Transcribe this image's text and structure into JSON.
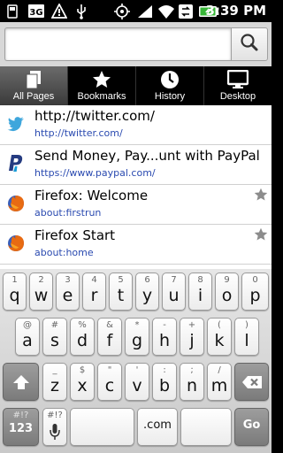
{
  "status_bar": {
    "time": "3:39 PM",
    "icons": [
      "usb-icon",
      "3g-signal-icon",
      "warning-icon",
      "usb-debug-icon",
      "gps-icon",
      "signal-icon",
      "wifi-icon",
      "battery-icon"
    ]
  },
  "url_bar": {
    "value": "",
    "placeholder": "",
    "search_icon": "search-icon"
  },
  "tabs": [
    {
      "label": "All Pages",
      "icon": "pages-icon",
      "selected": true
    },
    {
      "label": "Bookmarks",
      "icon": "star-icon",
      "selected": false
    },
    {
      "label": "History",
      "icon": "clock-icon",
      "selected": false
    },
    {
      "label": "Desktop",
      "icon": "monitor-icon",
      "selected": false
    }
  ],
  "list": [
    {
      "title": "http://twitter.com/",
      "url": "http://twitter.com/",
      "favicon": "twitter-bird-icon",
      "starred": false
    },
    {
      "title": "Send Money, Pay...unt with PayPal",
      "url": "https://www.paypal.com/",
      "favicon": "paypal-icon",
      "starred": false
    },
    {
      "title": "Firefox: Welcome",
      "url": "about:firstrun",
      "favicon": "firefox-icon",
      "starred": true
    },
    {
      "title": "Firefox Start",
      "url": "about:home",
      "favicon": "firefox-icon",
      "starred": true
    }
  ],
  "keyboard": {
    "row1": [
      {
        "main": "q",
        "alt": "1"
      },
      {
        "main": "w",
        "alt": "2"
      },
      {
        "main": "e",
        "alt": "3"
      },
      {
        "main": "r",
        "alt": "4"
      },
      {
        "main": "t",
        "alt": "5"
      },
      {
        "main": "y",
        "alt": "6"
      },
      {
        "main": "u",
        "alt": "7"
      },
      {
        "main": "i",
        "alt": "8"
      },
      {
        "main": "o",
        "alt": "9"
      },
      {
        "main": "p",
        "alt": "0"
      }
    ],
    "row2": [
      {
        "main": "a",
        "alt": "@"
      },
      {
        "main": "s",
        "alt": "#"
      },
      {
        "main": "d",
        "alt": "%"
      },
      {
        "main": "f",
        "alt": "&"
      },
      {
        "main": "g",
        "alt": "*"
      },
      {
        "main": "h",
        "alt": "-"
      },
      {
        "main": "j",
        "alt": "+"
      },
      {
        "main": "k",
        "alt": "("
      },
      {
        "main": "l",
        "alt": ")"
      }
    ],
    "row3": [
      {
        "main": "z",
        "alt": "_"
      },
      {
        "main": "x",
        "alt": "$"
      },
      {
        "main": "c",
        "alt": "\""
      },
      {
        "main": "v",
        "alt": "'"
      },
      {
        "main": "b",
        "alt": ":"
      },
      {
        "main": "n",
        "alt": ";"
      },
      {
        "main": "m",
        "alt": "/"
      }
    ],
    "symbols_key": {
      "main": "123",
      "alt": "#!?"
    },
    "mic_key": {
      "alt": "#!?"
    },
    "dotcom_key": {
      "main": ".com"
    },
    "go_key": {
      "main": "Go"
    },
    "accent_color": "#7b7b7b"
  }
}
